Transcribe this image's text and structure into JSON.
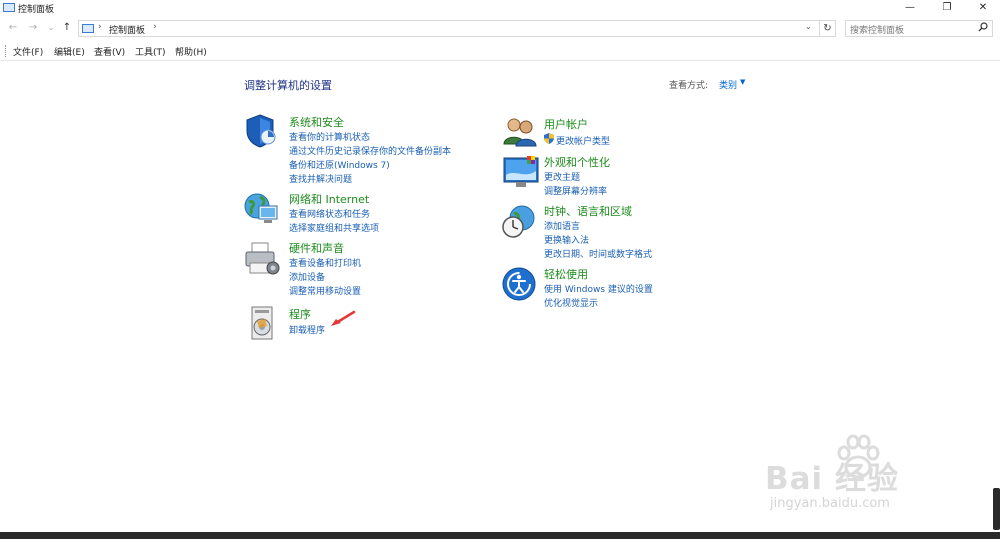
{
  "window": {
    "title": "控制面板",
    "minimize": "—",
    "restore": "❐",
    "close": "✕"
  },
  "nav": {
    "back": "←",
    "forward": "→",
    "recent": "⌄",
    "up": "↑",
    "address_sep": "›",
    "breadcrumb": "控制面板",
    "address_dropdown": "⌄",
    "refresh": "↻",
    "search_placeholder": "搜索控制面板"
  },
  "menu": [
    "文件(F)",
    "编辑(E)",
    "查看(V)",
    "工具(T)",
    "帮助(H)"
  ],
  "content": {
    "heading": "调整计算机的设置",
    "view_by_label": "查看方式:",
    "view_by_value": "类别",
    "left_categories": [
      {
        "title": "系统和安全",
        "icon": "shield-icon",
        "links": [
          "查看你的计算机状态",
          "通过文件历史记录保存你的文件备份副本",
          "备份和还原(Windows 7)",
          "查找并解决问题"
        ]
      },
      {
        "title": "网络和 Internet",
        "icon": "network-globe-icon",
        "links": [
          "查看网络状态和任务",
          "选择家庭组和共享选项"
        ]
      },
      {
        "title": "硬件和声音",
        "icon": "printer-icon",
        "links": [
          "查看设备和打印机",
          "添加设备",
          "调整常用移动设置"
        ]
      },
      {
        "title": "程序",
        "icon": "programs-icon",
        "links": [
          "卸载程序"
        ]
      }
    ],
    "right_categories": [
      {
        "title": "用户帐户",
        "icon": "users-icon",
        "links": [
          "更改帐户类型"
        ]
      },
      {
        "title": "外观和个性化",
        "icon": "monitor-palette-icon",
        "links": [
          "更改主题",
          "调整屏幕分辨率"
        ]
      },
      {
        "title": "时钟、语言和区域",
        "icon": "clock-globe-icon",
        "links": [
          "添加语言",
          "更换输入法",
          "更改日期、时间或数字格式"
        ]
      },
      {
        "title": "轻松使用",
        "icon": "ease-of-access-icon",
        "links": [
          "使用 Windows 建议的设置",
          "优化视觉显示"
        ]
      }
    ]
  },
  "watermark": {
    "logo": "Bai 经验",
    "url": "jingyan.baidu.com"
  },
  "colors": {
    "category_title": "#1c8b1c",
    "link": "#1a5fb4",
    "heading": "#1e3287",
    "annotation_arrow": "#e53935"
  }
}
